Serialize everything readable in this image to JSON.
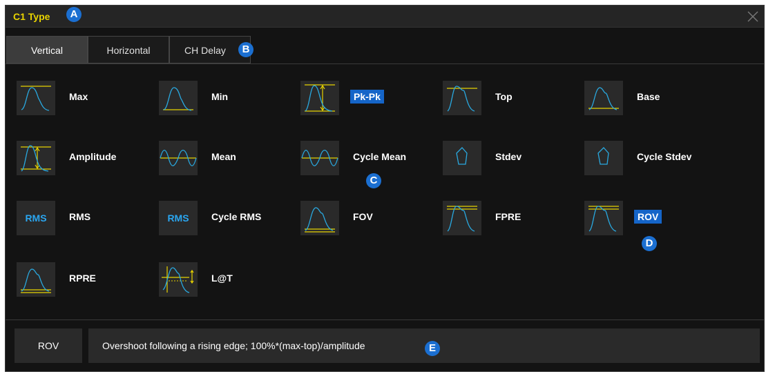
{
  "dialog": {
    "title": "C1 Type"
  },
  "tabs": [
    {
      "label": "Vertical",
      "active": true
    },
    {
      "label": "Horizontal",
      "active": false
    },
    {
      "label": "CH Delay",
      "active": false
    }
  ],
  "measurements": [
    {
      "label": "Max",
      "icon": "max-waveform-icon"
    },
    {
      "label": "Min",
      "icon": "min-waveform-icon"
    },
    {
      "label": "Pk-Pk",
      "icon": "pk-pk-waveform-icon",
      "selected": true
    },
    {
      "label": "Top",
      "icon": "top-waveform-icon"
    },
    {
      "label": "Base",
      "icon": "base-waveform-icon"
    },
    {
      "label": "Amplitude",
      "icon": "amplitude-waveform-icon"
    },
    {
      "label": "Mean",
      "icon": "mean-waveform-icon"
    },
    {
      "label": "Cycle Mean",
      "icon": "cycle-mean-waveform-icon"
    },
    {
      "label": "Stdev",
      "icon": "stdev-icon"
    },
    {
      "label": "Cycle Stdev",
      "icon": "cycle-stdev-icon"
    },
    {
      "label": "RMS",
      "icon_text": "RMS",
      "icon": "rms-icon"
    },
    {
      "label": "Cycle RMS",
      "icon_text": "RMS",
      "icon": "cycle-rms-icon"
    },
    {
      "label": "FOV",
      "icon": "fov-waveform-icon"
    },
    {
      "label": "FPRE",
      "icon": "fpre-waveform-icon"
    },
    {
      "label": "ROV",
      "icon": "rov-waveform-icon",
      "selected": true
    },
    {
      "label": "RPRE",
      "icon": "rpre-waveform-icon"
    },
    {
      "label": "L@T",
      "icon": "level-at-time-icon"
    }
  ],
  "description": {
    "name": "ROV",
    "text": "Overshoot following a rising edge; 100%*(max-top)/amplitude"
  },
  "callouts": [
    "A",
    "B",
    "C",
    "D",
    "E"
  ],
  "colors": {
    "title": "#e8d300",
    "wave": "#29a9e0",
    "marker": "#e8d300",
    "selection": "#1565c8",
    "callout": "#1b6fd1"
  }
}
